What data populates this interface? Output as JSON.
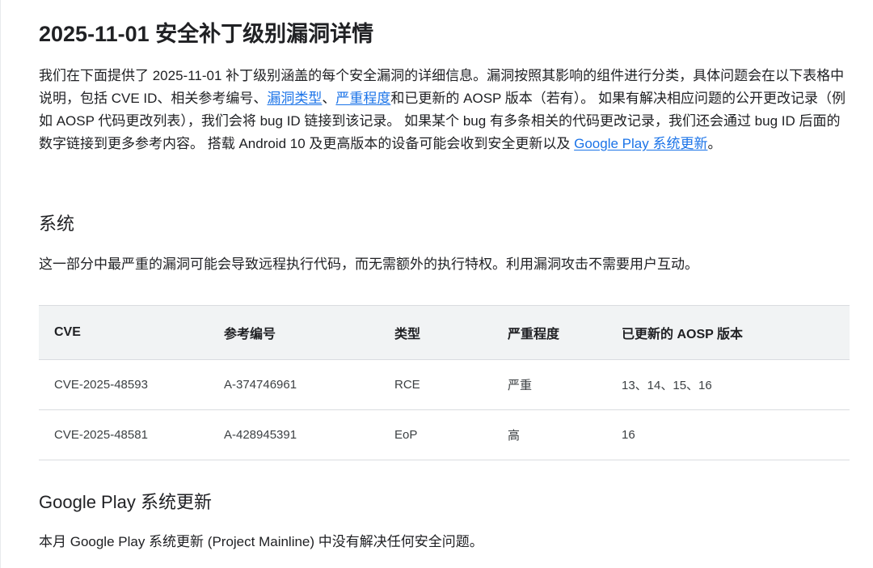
{
  "page": {
    "title": "2025-11-01 安全补丁级别漏洞详情",
    "intro": {
      "part1": "我们在下面提供了 2025-11-01 补丁级别涵盖的每个安全漏洞的详细信息。漏洞按照其影响的组件进行分类，具体问题会在以下表格中说明，包括 CVE ID、相关参考编号、",
      "link_type": "漏洞类型",
      "sep": "、",
      "link_severity": "严重程度",
      "part2": "和已更新的 AOSP 版本（若有）。 如果有解决相应问题的公开更改记录（例如 AOSP 代码更改列表），我们会将 bug ID 链接到该记录。 如果某个 bug 有多条相关的代码更改记录，我们还会通过 bug ID 后面的数字链接到更多参考内容。 搭载 Android 10 及更高版本的设备可能会收到安全更新以及 ",
      "link_gp": "Google Play 系统更新",
      "end": "。"
    }
  },
  "system": {
    "heading": "系统",
    "description": "这一部分中最严重的漏洞可能会导致远程执行代码，而无需额外的执行特权。利用漏洞攻击不需要用户互动。",
    "table": {
      "headers": [
        "CVE",
        "参考编号",
        "类型",
        "严重程度",
        "已更新的 AOSP 版本"
      ],
      "rows": [
        [
          "CVE-2025-48593",
          "A-374746961",
          "RCE",
          "严重",
          "13、14、15、16"
        ],
        [
          "CVE-2025-48581",
          "A-428945391",
          "EoP",
          "高",
          "16"
        ]
      ]
    }
  },
  "google_play": {
    "heading": "Google Play 系统更新",
    "description": "本月 Google Play 系统更新 (Project Mainline) 中没有解决任何安全问题。"
  },
  "colors": {
    "link": "#1a73e8",
    "header_bg": "#f1f3f4",
    "border": "#dadce0"
  }
}
